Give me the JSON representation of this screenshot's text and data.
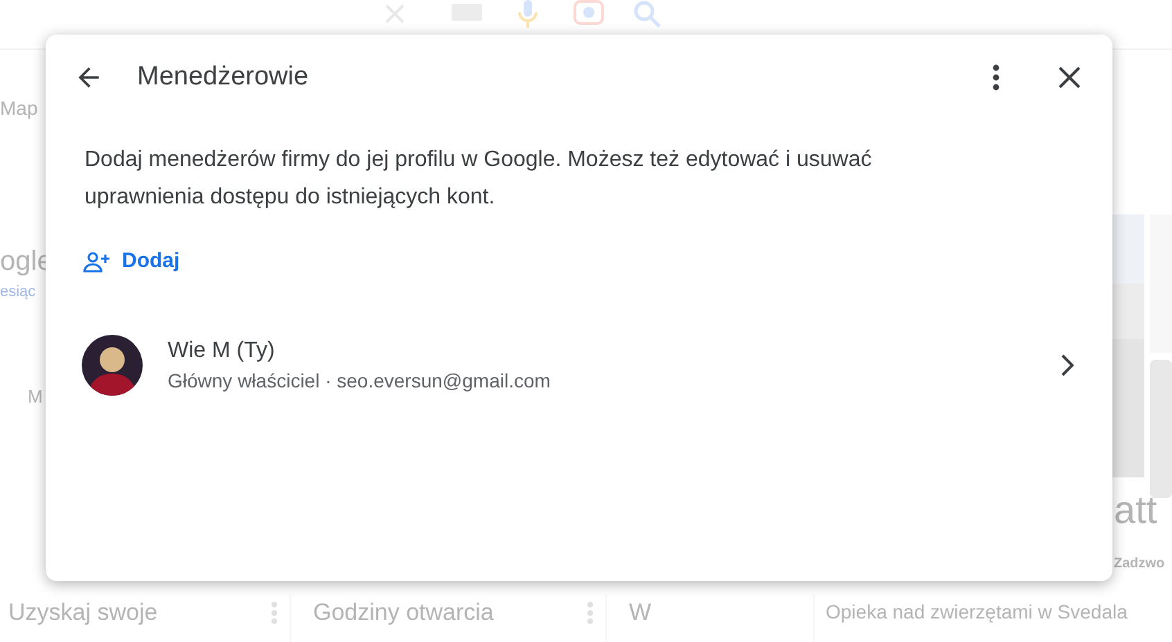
{
  "background": {
    "texts": [
      {
        "kind": "tab",
        "text": "Map"
      },
      {
        "kind": "title",
        "text": "ogle"
      },
      {
        "kind": "link",
        "text": "esiąc"
      },
      {
        "kind": "letter",
        "text": "M"
      },
      {
        "kind": "heading",
        "text": "att"
      },
      {
        "kind": "small",
        "text": "Zadzwo"
      },
      {
        "kind": "category",
        "text": "Opieka nad zwierzętami w Svedala"
      }
    ],
    "cards": [
      {
        "text": "Uzyskaj swoje"
      },
      {
        "text": "Godziny otwarcia"
      },
      {
        "text": "W"
      }
    ]
  },
  "dialog": {
    "title": "Menedżerowie",
    "description": "Dodaj menedżerów firmy do jej profilu w Google. Możesz też edytować i usuwać uprawnienia dostępu do istniejących kont.",
    "add_label": "Dodaj",
    "managers": [
      {
        "name": "Wie M (Ty)",
        "role": "Główny właściciel",
        "separator": "·",
        "email": "seo.eversun@gmail.com"
      }
    ]
  }
}
